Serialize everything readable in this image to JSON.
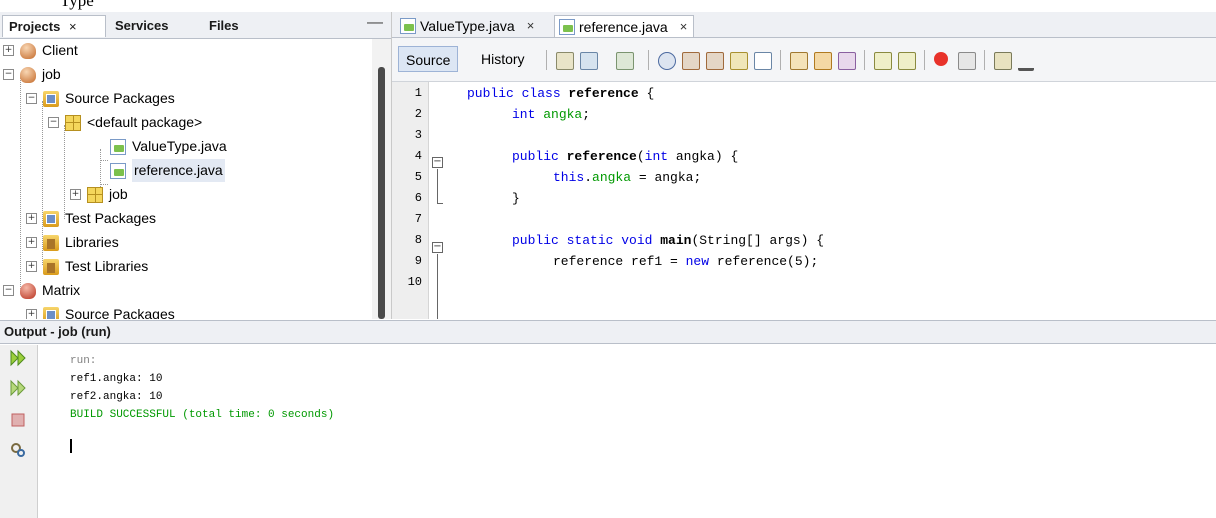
{
  "top_partial_text": "Type",
  "left_panel": {
    "tabs": [
      {
        "label": "Projects",
        "close": "×"
      },
      {
        "label": "Services"
      },
      {
        "label": "Files"
      }
    ],
    "minimize": "—",
    "tree": [
      {
        "label": "Client"
      },
      {
        "label": "job"
      },
      {
        "label": "Source Packages"
      },
      {
        "label": "<default package>"
      },
      {
        "label": "ValueType.java"
      },
      {
        "label": "reference.java"
      },
      {
        "label": "job"
      },
      {
        "label": "Test Packages"
      },
      {
        "label": "Libraries"
      },
      {
        "label": "Test Libraries"
      },
      {
        "label": "Matrix"
      },
      {
        "label": "Source Packages"
      }
    ]
  },
  "editor": {
    "tabs": [
      {
        "label": "ValueType.java",
        "close": "×"
      },
      {
        "label": "reference.java",
        "close": "×"
      }
    ],
    "toolbar": {
      "source": "Source",
      "history": "History"
    },
    "line_numbers": [
      "1",
      "2",
      "3",
      "4",
      "5",
      "6",
      "7",
      "8",
      "9",
      "10"
    ],
    "code": {
      "l1": {
        "a": "public class ",
        "b": "reference",
        "c": " {"
      },
      "l2": {
        "a": "int ",
        "b": "angka",
        "c": ";"
      },
      "l4": {
        "a": "public ",
        "b": "reference",
        "c": "(",
        "d": "int",
        "e": " angka) {"
      },
      "l5": {
        "a": "this",
        "b": ".",
        "c": "angka",
        "d": " = angka;"
      },
      "l6": {
        "a": "}"
      },
      "l8": {
        "a": "public static void ",
        "b": "main",
        "c": "(String[] args) {"
      },
      "l9": {
        "a": "reference ref1 = ",
        "b": "new",
        "c": " reference(5);"
      }
    }
  },
  "output": {
    "title": "Output - job (run)",
    "lines": [
      {
        "text": "run:",
        "color": "#808080"
      },
      {
        "text": "ref1.angka: 10",
        "color": "#000000"
      },
      {
        "text": "ref2.angka: 10",
        "color": "#000000"
      },
      {
        "text": "BUILD SUCCESSFUL (total time: 0 seconds)",
        "color": "#009900"
      }
    ]
  },
  "colors": {
    "keyword": "#0000e6",
    "field": "#009900",
    "selection": "#e3e9f3"
  }
}
